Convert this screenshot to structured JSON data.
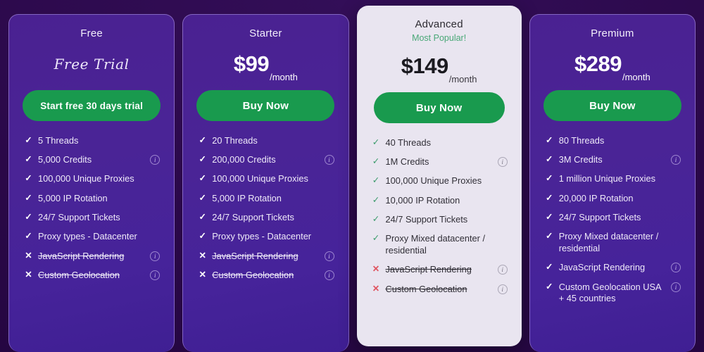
{
  "theme": {
    "page_background": "#2b0a4e",
    "card_background": "#4a2191",
    "featured_card_background": "#e9e5f0",
    "cta_green": "#199a4e",
    "popular_green": "#49a877",
    "cross_red": "#e05561"
  },
  "icons": {
    "check": "✓",
    "cross": "✕",
    "info": "i"
  },
  "plans": [
    {
      "name": "Free",
      "featured": false,
      "popular_label": "",
      "price_style": "script",
      "trial_text": "Free Trial",
      "price_amount": "",
      "price_period": "",
      "cta_label": "Start free 30 days trial",
      "features": [
        {
          "text": "5 Threads",
          "included": true,
          "info": false
        },
        {
          "text": "5,000 Credits",
          "included": true,
          "info": true
        },
        {
          "text": "100,000 Unique Proxies",
          "included": true,
          "info": false
        },
        {
          "text": "5,000 IP Rotation",
          "included": true,
          "info": false
        },
        {
          "text": "24/7 Support Tickets",
          "included": true,
          "info": false
        },
        {
          "text": "Proxy types - Datacenter",
          "included": true,
          "info": false
        },
        {
          "text": "JavaScript Rendering",
          "included": false,
          "info": true
        },
        {
          "text": "Custom Geolocation",
          "included": false,
          "info": true
        }
      ]
    },
    {
      "name": "Starter",
      "featured": false,
      "popular_label": "",
      "price_style": "price",
      "trial_text": "",
      "price_amount": "$99",
      "price_period": "/month",
      "cta_label": "Buy Now",
      "features": [
        {
          "text": "20 Threads",
          "included": true,
          "info": false
        },
        {
          "text": "200,000 Credits",
          "included": true,
          "info": true
        },
        {
          "text": "100,000 Unique Proxies",
          "included": true,
          "info": false
        },
        {
          "text": "5,000 IP Rotation",
          "included": true,
          "info": false
        },
        {
          "text": "24/7 Support Tickets",
          "included": true,
          "info": false
        },
        {
          "text": "Proxy types - Datacenter",
          "included": true,
          "info": false
        },
        {
          "text": "JavaScript Rendering",
          "included": false,
          "info": true
        },
        {
          "text": "Custom Geolocation",
          "included": false,
          "info": true
        }
      ]
    },
    {
      "name": "Advanced",
      "featured": true,
      "popular_label": "Most Popular!",
      "price_style": "price",
      "trial_text": "",
      "price_amount": "$149",
      "price_period": "/month",
      "cta_label": "Buy Now",
      "features": [
        {
          "text": "40 Threads",
          "included": true,
          "info": false
        },
        {
          "text": "1M Credits",
          "included": true,
          "info": true
        },
        {
          "text": "100,000 Unique Proxies",
          "included": true,
          "info": false
        },
        {
          "text": "10,000 IP Rotation",
          "included": true,
          "info": false
        },
        {
          "text": "24/7 Support Tickets",
          "included": true,
          "info": false
        },
        {
          "text": "Proxy Mixed datacenter / residential",
          "included": true,
          "info": false
        },
        {
          "text": "JavaScript Rendering",
          "included": false,
          "info": true
        },
        {
          "text": "Custom Geolocation",
          "included": false,
          "info": true
        }
      ]
    },
    {
      "name": "Premium",
      "featured": false,
      "popular_label": "",
      "price_style": "price",
      "trial_text": "",
      "price_amount": "$289",
      "price_period": "/month",
      "cta_label": "Buy Now",
      "features": [
        {
          "text": "80 Threads",
          "included": true,
          "info": false
        },
        {
          "text": "3M Credits",
          "included": true,
          "info": true
        },
        {
          "text": "1 million Unique Proxies",
          "included": true,
          "info": false
        },
        {
          "text": "20,000 IP Rotation",
          "included": true,
          "info": false
        },
        {
          "text": "24/7 Support Tickets",
          "included": true,
          "info": false
        },
        {
          "text": "Proxy Mixed datacenter / residential",
          "included": true,
          "info": false
        },
        {
          "text": "JavaScript Rendering",
          "included": true,
          "info": true
        },
        {
          "text": "Custom Geolocation USA + 45 countries",
          "included": true,
          "info": true
        }
      ]
    }
  ]
}
